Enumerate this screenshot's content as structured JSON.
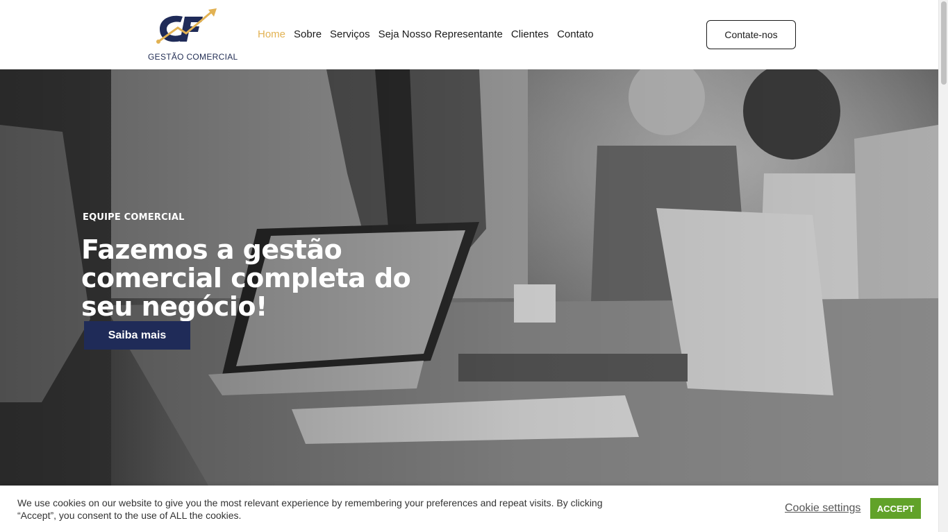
{
  "header": {
    "logo_text": "GESTÃO COMERCIAL",
    "nav": [
      {
        "label": "Home",
        "active": true
      },
      {
        "label": "Sobre",
        "active": false
      },
      {
        "label": "Serviços",
        "active": false
      },
      {
        "label": "Seja Nosso Representante",
        "active": false
      },
      {
        "label": "Clientes",
        "active": false
      },
      {
        "label": "Contato",
        "active": false
      }
    ],
    "cta_label": "Contate-nos"
  },
  "hero": {
    "eyebrow": "EQUIPE COMERCIAL",
    "headline": "Fazemos a gestão comercial completa do seu negócio!",
    "button_label": "Saiba mais"
  },
  "cookie": {
    "text": "We use cookies on our website to give you the most relevant experience by remembering your preferences and repeat visits. By clicking “Accept”, you consent to the use of ALL the cookies.",
    "settings_label": "Cookie settings",
    "accept_label": "ACCEPT"
  },
  "colors": {
    "accent": "#e2b253",
    "brand_navy": "#1f2b58",
    "accept_green": "#61a229"
  }
}
